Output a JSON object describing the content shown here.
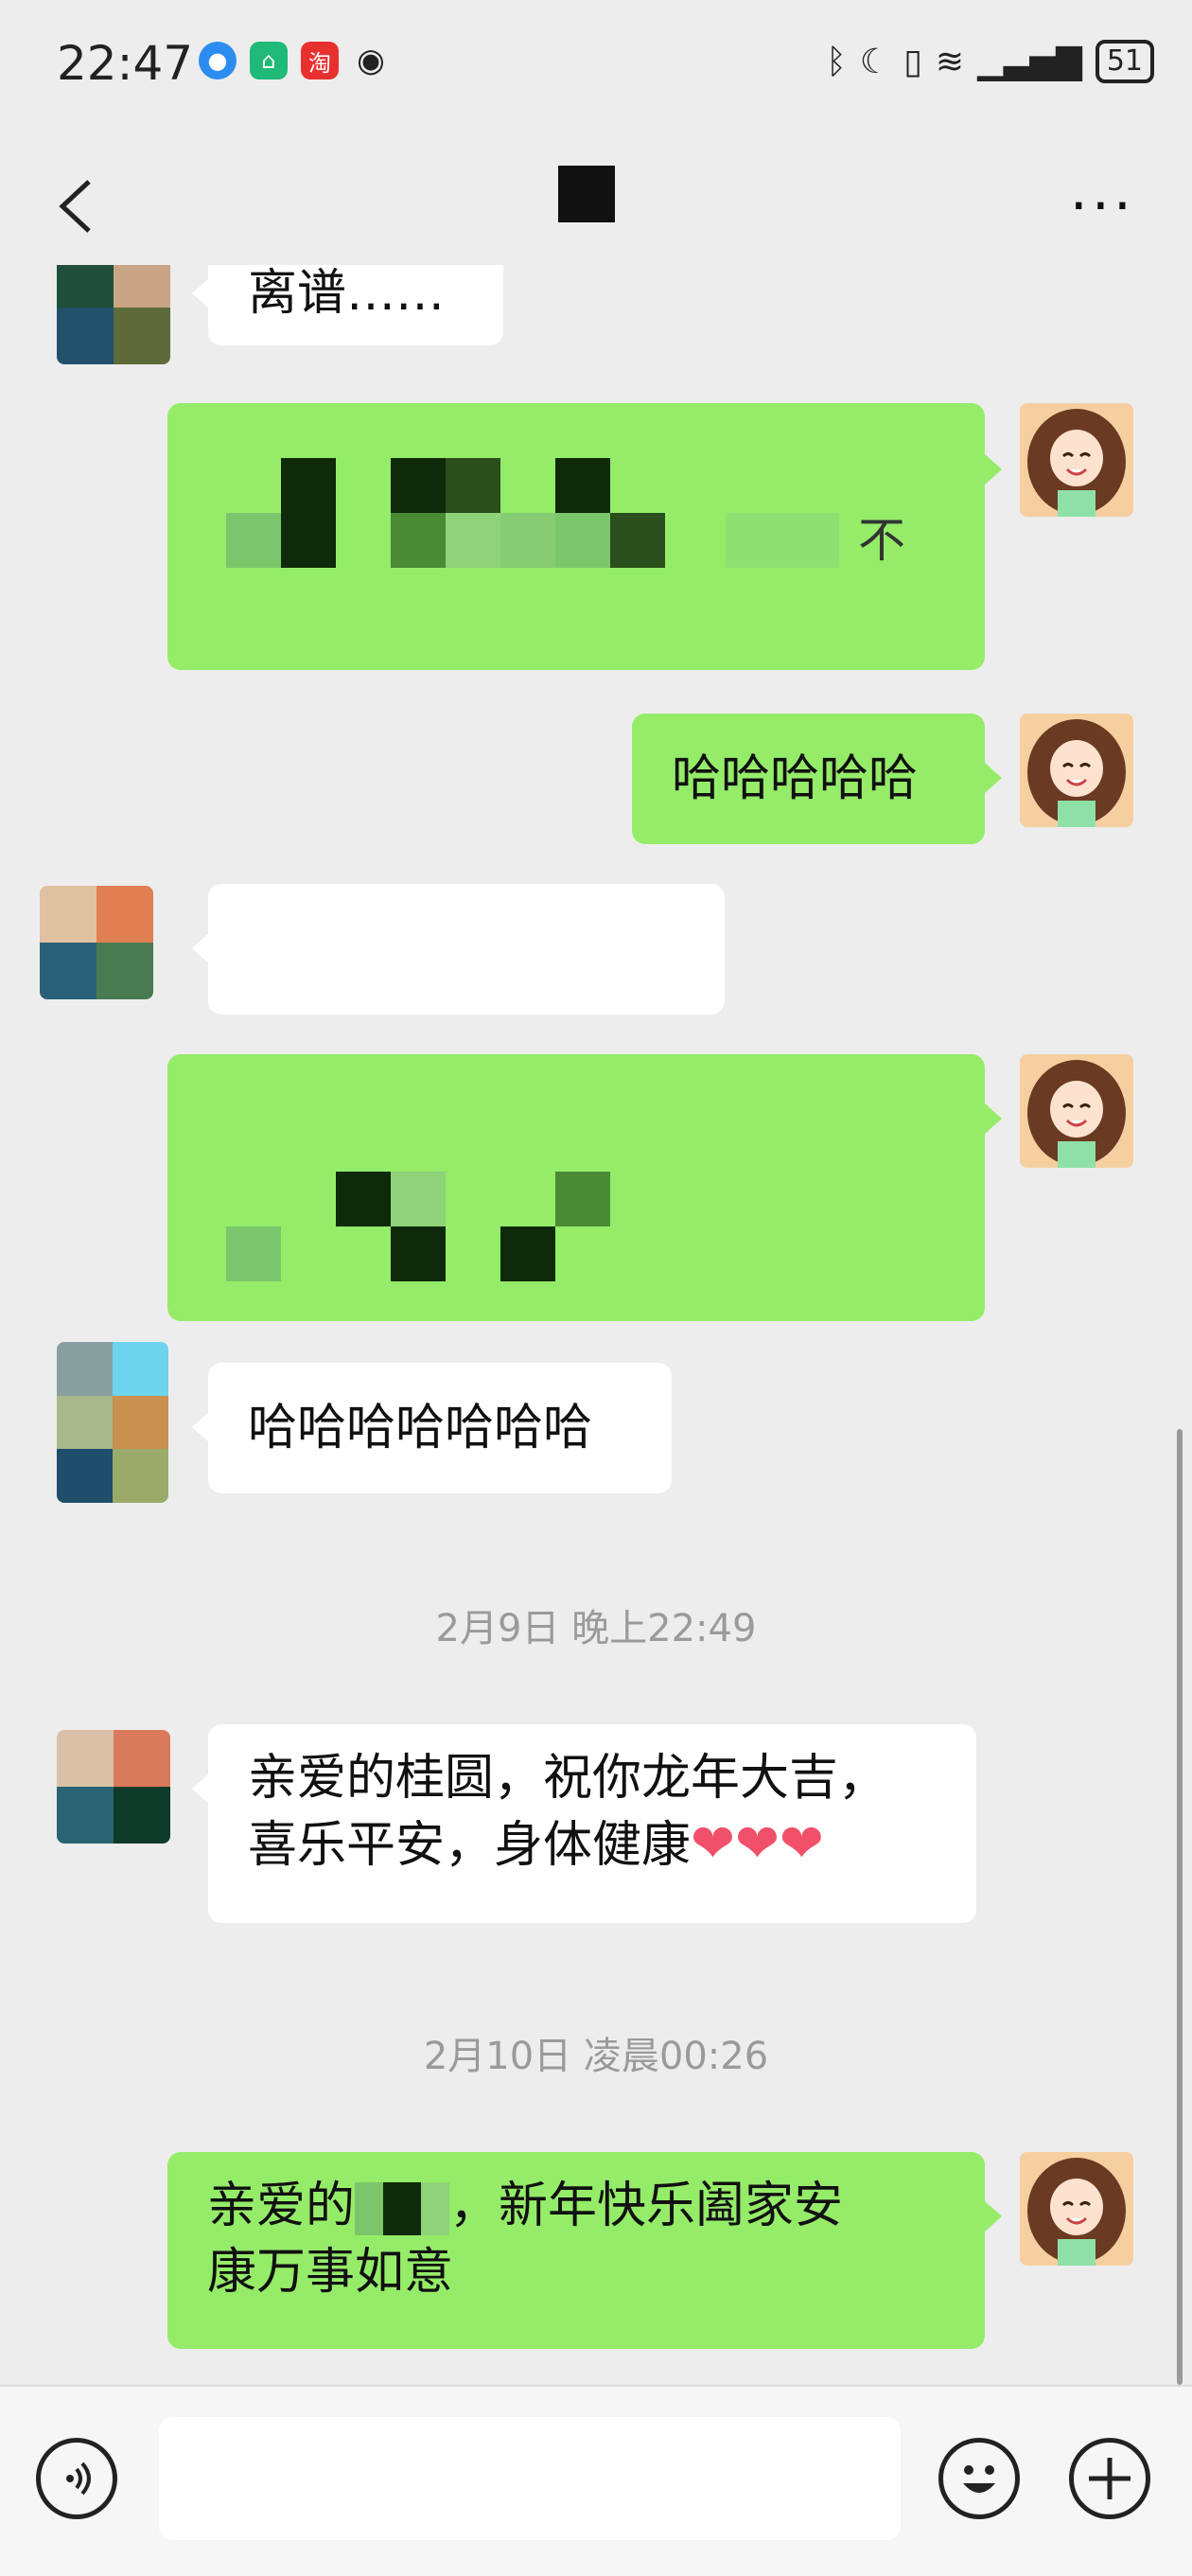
{
  "status_bar": {
    "time": "22:47",
    "battery": "51",
    "icons": [
      "browser-icon",
      "app-store-icon",
      "taobao-icon",
      "eye-icon",
      "bluetooth-icon",
      "moon-icon",
      "vibrate-icon",
      "wifi-icon",
      "signal-icon"
    ]
  },
  "nav": {
    "back_icon": "back-chevron-icon",
    "more_icon": "more-dots-icon"
  },
  "messages": {
    "m1_text": "离谱……",
    "m2_partial": "不",
    "m3_text": "哈哈哈哈哈",
    "m6_text": "哈哈哈哈哈哈哈",
    "time1": "2月9日 晚上22:49",
    "m7_line1": "亲爱的桂圆，祝你龙年大吉，",
    "m7_line2": "喜乐平安，身体健康",
    "m7_hearts": "❤❤❤",
    "time2": "2月10日 凌晨00:26",
    "m8_part1": "亲爱的",
    "m8_part2": "，新年快乐阖家安",
    "m8_line2": "康万事如意"
  },
  "input_bar": {
    "voice_icon": "voice-icon",
    "emoji_icon": "emoji-icon",
    "plus_icon": "plus-icon",
    "input_value": ""
  },
  "colors": {
    "outgoing": "#95ec69",
    "incoming": "#ffffff",
    "background": "#ededed"
  }
}
